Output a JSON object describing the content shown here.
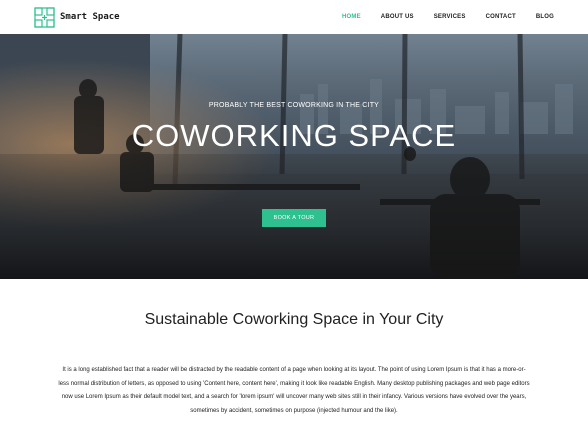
{
  "navbar": {
    "brand": "Smart Space",
    "logo_icon": "grid-logo-icon",
    "links": [
      {
        "label": "HOME",
        "active": true
      },
      {
        "label": "ABOUT US",
        "active": false
      },
      {
        "label": "SERVICES",
        "active": false
      },
      {
        "label": "CONTACT",
        "active": false
      },
      {
        "label": "BLOG",
        "active": false
      }
    ],
    "active_color": "#2ec08f"
  },
  "hero": {
    "kicker": "PROBABLY THE BEST COWORKING IN THE CITY",
    "title": "COWORKING SPACE",
    "button_label": "BOOK A TOUR",
    "button_color": "#2ec08f"
  },
  "intro": {
    "title": "Sustainable Coworking Space in Your City",
    "body": "It is a long established fact that a reader will be distracted by the readable content of a page when looking at its layout. The point of using Lorem Ipsum is that it has a more-or-less normal distribution of letters, as opposed to using 'Content here, content here', making it look like readable English. Many desktop publishing packages and web page editors now use Lorem Ipsum as their default model text, and a search for 'lorem ipsum' will uncover many web sites still in their infancy. Various versions have evolved over the years, sometimes by accident, sometimes on purpose (injected humour and the like)."
  }
}
